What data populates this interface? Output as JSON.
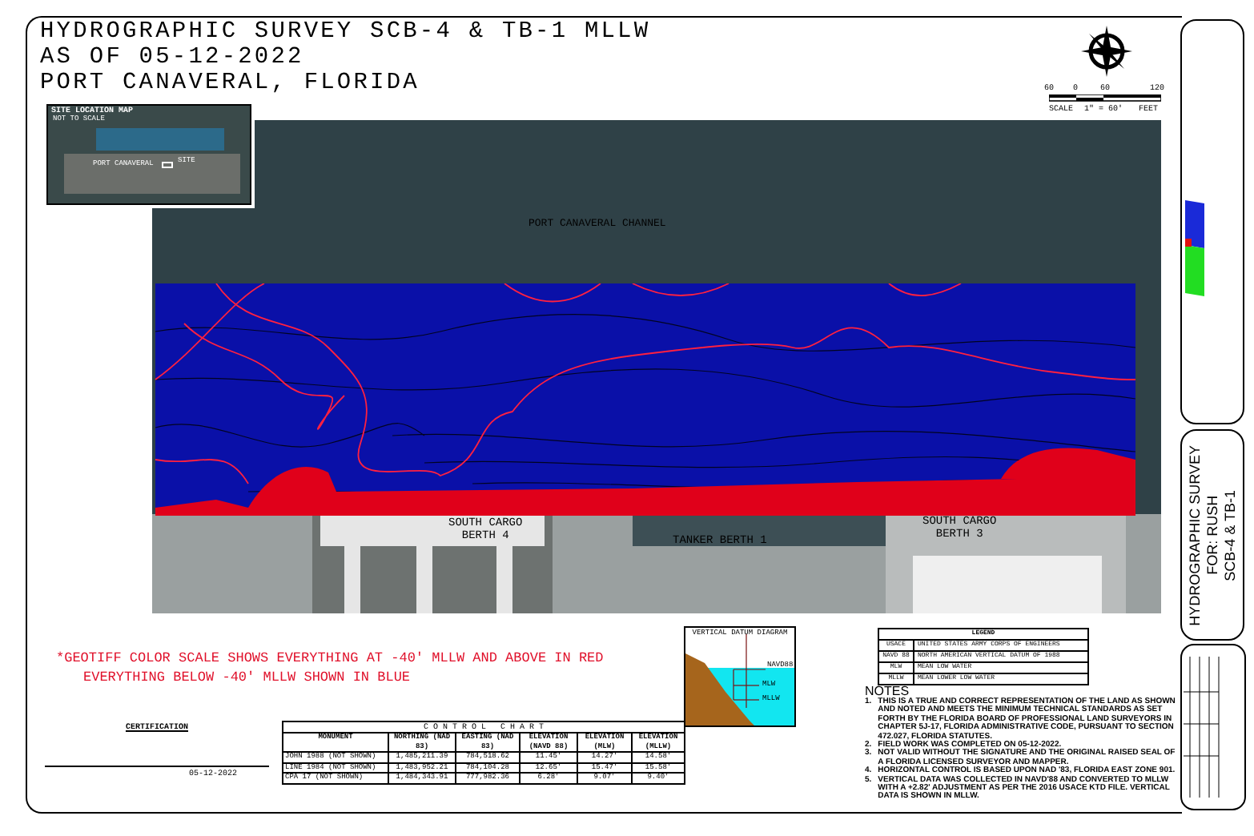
{
  "title_lines": [
    "HYDROGRAPHIC SURVEY SCB-4 & TB-1 MLLW",
    "AS OF 05-12-2022",
    "PORT CANAVERAL, FLORIDA"
  ],
  "site_map": {
    "title": "SITE LOCATION MAP",
    "subtitle": "NOT TO SCALE",
    "place": "PORT CANAVERAL",
    "site": "SITE"
  },
  "plan": {
    "channel": "PORT CANAVERAL CHANNEL",
    "berths": [
      {
        "line1": "SOUTH CARGO",
        "line2": "BERTH 4"
      },
      {
        "line1": "TANKER BERTH 1"
      },
      {
        "line1": "SOUTH CARGO",
        "line2": "BERTH 3"
      }
    ]
  },
  "north_scale": {
    "ticks": [
      "60",
      "0",
      "60",
      "120"
    ],
    "label": "SCALE",
    "ratio": "1\" = 60'",
    "unit": "FEET"
  },
  "geotiff_note": [
    "*GEOTIFF COLOR SCALE SHOWS EVERYTHING AT -40' MLLW AND ABOVE IN RED",
    "EVERYTHING BELOW -40' MLLW SHOWN IN BLUE"
  ],
  "certification": {
    "title": "CERTIFICATION",
    "date": "05-12-2022"
  },
  "control_chart": {
    "title": "C O N T R O L   C H A R T",
    "columns": [
      "MONUMENT",
      "NORTHING (NAD 83)",
      "EASTING (NAD 83)",
      "ELEVATION (NAVD 88)",
      "ELEVATION (MLW)",
      "ELEVATION (MLLW)"
    ],
    "rows": [
      [
        "JOHN 1988 (NOT SHOWN)",
        "1,485,211.39",
        "784,518.62",
        "11.45'",
        "14.27'",
        "14.58'"
      ],
      [
        "LINE 1984 (NOT SHOWN)",
        "1,483,952.21",
        "784,104.28",
        "12.65'",
        "15.47'",
        "15.58'"
      ],
      [
        "CPA 17 (NOT SHOWN)",
        "1,484,343.91",
        "777,982.36",
        "6.28'",
        "9.07'",
        "9.40'"
      ]
    ]
  },
  "datum_diagram": {
    "title": "VERTICAL DATUM DIAGRAM",
    "labels": [
      "NAVD88",
      "MLW",
      "MLLW"
    ]
  },
  "legend": {
    "title": "LEGEND",
    "rows": [
      {
        "abbr": "USACE",
        "meaning": "UNITED STATES ARMY CORPS OF ENGINEERS"
      },
      {
        "abbr": "NAVD 88",
        "meaning": "NORTH AMERICAN VERTICAL DATUM OF 1988"
      },
      {
        "abbr": "MLW",
        "meaning": "MEAN LOW WATER"
      },
      {
        "abbr": "MLLW",
        "meaning": "MEAN LOWER LOW WATER"
      }
    ]
  },
  "notes": {
    "title": "NOTES",
    "numbers": [
      "1.",
      "2.",
      "3.",
      "4.",
      "5."
    ],
    "items": [
      "THIS IS A TRUE AND CORRECT REPRESENTATION OF THE LAND AS SHOWN AND NOTED AND MEETS THE MINIMUM TECHNICAL STANDARDS AS SET FORTH BY THE FLORIDA BOARD OF PROFESSIONAL LAND SURVEYORS IN CHAPTER 5J-17, FLORIDA ADMINISTRATIVE CODE, PURSUANT TO SECTION 472.027, FLORIDA STATUTES.",
      "FIELD WORK WAS COMPLETED ON 05-12-2022.",
      "NOT VALID WITHOUT THE SIGNATURE AND THE ORIGINAL RAISED SEAL OF A FLORIDA LICENSED SURVEYOR AND MAPPER.",
      "HORIZONTAL CONTROL IS BASED UPON NAD '83, FLORIDA EAST ZONE 901.",
      "VERTICAL DATA WAS COLLECTED IN NAVD'88 AND CONVERTED TO MLLW WITH A +2.82' ADJUSTMENT AS PER THE 2016 USACE KTD FILE. VERTICAL DATA IS SHOWN IN MLLW."
    ]
  },
  "title_block": {
    "lines": [
      "HYDROGRAPHIC SURVEY",
      "FOR: RUSH",
      "SCB-4 & TB-1"
    ]
  }
}
